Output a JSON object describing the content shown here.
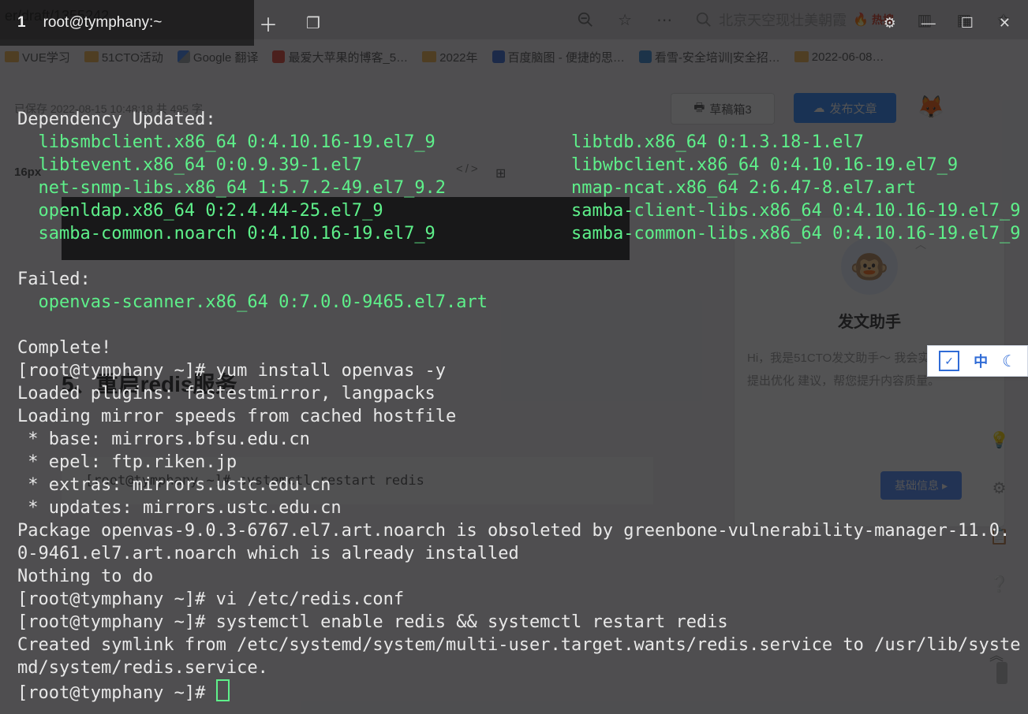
{
  "browser": {
    "address_fragment": "er/draft/1355242",
    "search_placeholder": "北京天空现壮美朝霞",
    "hot_label": "热搜",
    "bookmarks": [
      {
        "label": "VUE学习",
        "icon": "folder"
      },
      {
        "label": "51CTO活动",
        "icon": "folder"
      },
      {
        "label": "Google 翻译",
        "icon": "gtrans"
      },
      {
        "label": "最爱大苹果的博客_5…",
        "icon": "red"
      },
      {
        "label": "2022年",
        "icon": "folder"
      },
      {
        "label": "百度脑图 - 便捷的思…",
        "icon": "bdbrain"
      },
      {
        "label": "看雪-安全培训|安全招…",
        "icon": "snow"
      },
      {
        "label": "2022-06-08…",
        "icon": "folder"
      }
    ],
    "toolbar": {
      "saved_hint": "已保存   2022-08-15 10:48:18   共 495 字",
      "font_px": "16px",
      "draft_label": "草稿箱3",
      "publish_label": "发布文章"
    },
    "bg_heading": "5、重启redis服务",
    "bg_code": "[root@tymphany ~]# systemctl restart redis",
    "assistant": {
      "title": "发文助手",
      "desc": "Hi，我是51CTO发文助手～\n我会实时检测内容提出优化\n建议，帮您提升内容质量。"
    },
    "baseinfo_label": "基础信息",
    "ime": {
      "zh": "中"
    }
  },
  "terminal": {
    "tab_index": "1",
    "tab_title": "root@tymphany:~",
    "lines": [
      {
        "t": "",
        "c": "w"
      },
      {
        "t": "Dependency Updated:",
        "c": "w"
      },
      {
        "t": "  libsmbclient.x86_64 0:4.10.16-19.el7_9             libtdb.x86_64 0:1.3.18-1.el7",
        "c": "g"
      },
      {
        "t": "  libtevent.x86_64 0:0.9.39-1.el7                    libwbclient.x86_64 0:4.10.16-19.el7_9",
        "c": "g"
      },
      {
        "t": "  net-snmp-libs.x86_64 1:5.7.2-49.el7_9.2            nmap-ncat.x86_64 2:6.47-8.el7.art",
        "c": "g"
      },
      {
        "t": "  openldap.x86_64 0:2.4.44-25.el7_9                  samba-client-libs.x86_64 0:4.10.16-19.el7_9",
        "c": "g"
      },
      {
        "t": "  samba-common.noarch 0:4.10.16-19.el7_9             samba-common-libs.x86_64 0:4.10.16-19.el7_9",
        "c": "g"
      },
      {
        "t": "",
        "c": "w"
      },
      {
        "t": "Failed:",
        "c": "w"
      },
      {
        "t": "  openvas-scanner.x86_64 0:7.0.0-9465.el7.art",
        "c": "g"
      },
      {
        "t": "",
        "c": "w"
      },
      {
        "t": "Complete!",
        "c": "w"
      },
      {
        "t": "[root@tymphany ~]# yum install openvas -y",
        "c": "prompt"
      },
      {
        "t": "Loaded plugins: fastestmirror, langpacks",
        "c": "w"
      },
      {
        "t": "Loading mirror speeds from cached hostfile",
        "c": "w"
      },
      {
        "t": " * base: mirrors.bfsu.edu.cn",
        "c": "w"
      },
      {
        "t": " * epel: ftp.riken.jp",
        "c": "w"
      },
      {
        "t": " * extras: mirrors.ustc.edu.cn",
        "c": "w"
      },
      {
        "t": " * updates: mirrors.ustc.edu.cn",
        "c": "w"
      },
      {
        "t": "Package openvas-9.0.3-6767.el7.art.noarch is obsoleted by greenbone-vulnerability-manager-11.0.",
        "c": "w"
      },
      {
        "t": "0-9461.el7.art.noarch which is already installed",
        "c": "w"
      },
      {
        "t": "Nothing to do",
        "c": "w"
      },
      {
        "t": "[root@tymphany ~]# vi /etc/redis.conf",
        "c": "prompt"
      },
      {
        "t": "[root@tymphany ~]# systemctl enable redis && systemctl restart redis",
        "c": "prompt"
      },
      {
        "t": "Created symlink from /etc/systemd/system/multi-user.target.wants/redis.service to /usr/lib/syste",
        "c": "w"
      },
      {
        "t": "md/system/redis.service.",
        "c": "w"
      }
    ],
    "final_prompt": "[root@tymphany ~]# "
  }
}
